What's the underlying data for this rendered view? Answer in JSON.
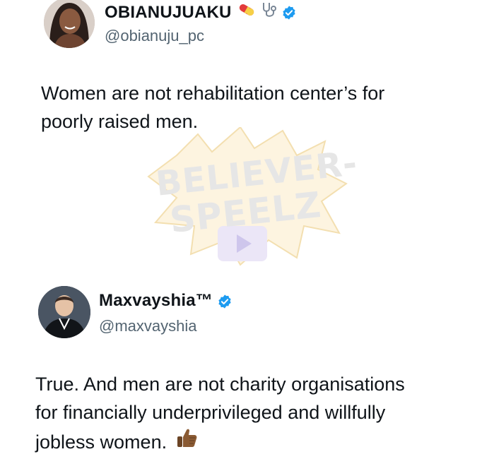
{
  "tweet1": {
    "display_name": "OBIANUJUAKU",
    "name_emojis": [
      "pill-icon",
      "stethoscope-icon"
    ],
    "verified": true,
    "handle": "@obianuju_pc",
    "text_line1": "Women are not rehabilitation center’s for",
    "text_line2": "poorly raised men."
  },
  "watermark": {
    "line1": "BELIEVER-",
    "line2": "SPEELZ"
  },
  "tweet2": {
    "display_name": "Maxvayshia™",
    "verified": true,
    "handle": "@maxvayshia",
    "text_line1": "True. And men are not charity organisations",
    "text_line2": "for financially underprivileged and willfully",
    "text_line3": "jobless women.",
    "emoji": "thumbs-up-icon"
  },
  "colors": {
    "verified_blue": "#1d9bf0",
    "handle_gray": "#536471",
    "text": "#0f1419"
  }
}
